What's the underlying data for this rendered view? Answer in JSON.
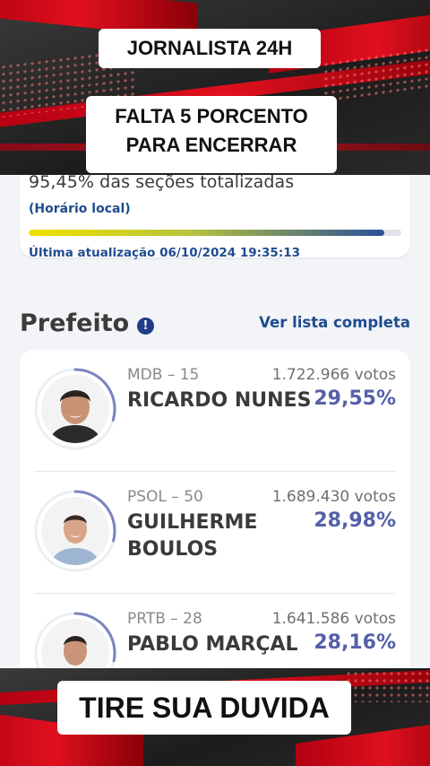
{
  "overlay": {
    "top_label": "JORNALISTA 24H",
    "headline_line1": "FALTA 5 PORCENTO",
    "headline_line2": "PARA ENCERRAR",
    "bottom_label": "TIRE SUA DUVIDA"
  },
  "status": {
    "sections_text": "95,45% das seções totalizadas",
    "sections_progress": 0.9545,
    "local_time_label": "(Horário local)",
    "last_update": "Última atualização 06/10/2024 19:35:13"
  },
  "section": {
    "title": "Prefeito",
    "info_icon": "info-icon",
    "see_all_label": "Ver lista completa"
  },
  "candidates": [
    {
      "party": "MDB – 15",
      "votes": "1.722.966 votos",
      "name": "RICARDO NUNES",
      "percent": "29,55%",
      "share": 0.2955
    },
    {
      "party": "PSOL – 50",
      "votes": "1.689.430 votos",
      "name": "GUILHERME BOULOS",
      "percent": "28,98%",
      "share": 0.2898
    },
    {
      "party": "PRTB – 28",
      "votes": "1.641.586 votos",
      "name": "PABLO MARÇAL",
      "percent": "28,16%",
      "share": 0.2816
    }
  ],
  "colors": {
    "accent_blue": "#1f4b8f",
    "percent_purple": "#5560a8",
    "banner_red": "#e0101e"
  }
}
